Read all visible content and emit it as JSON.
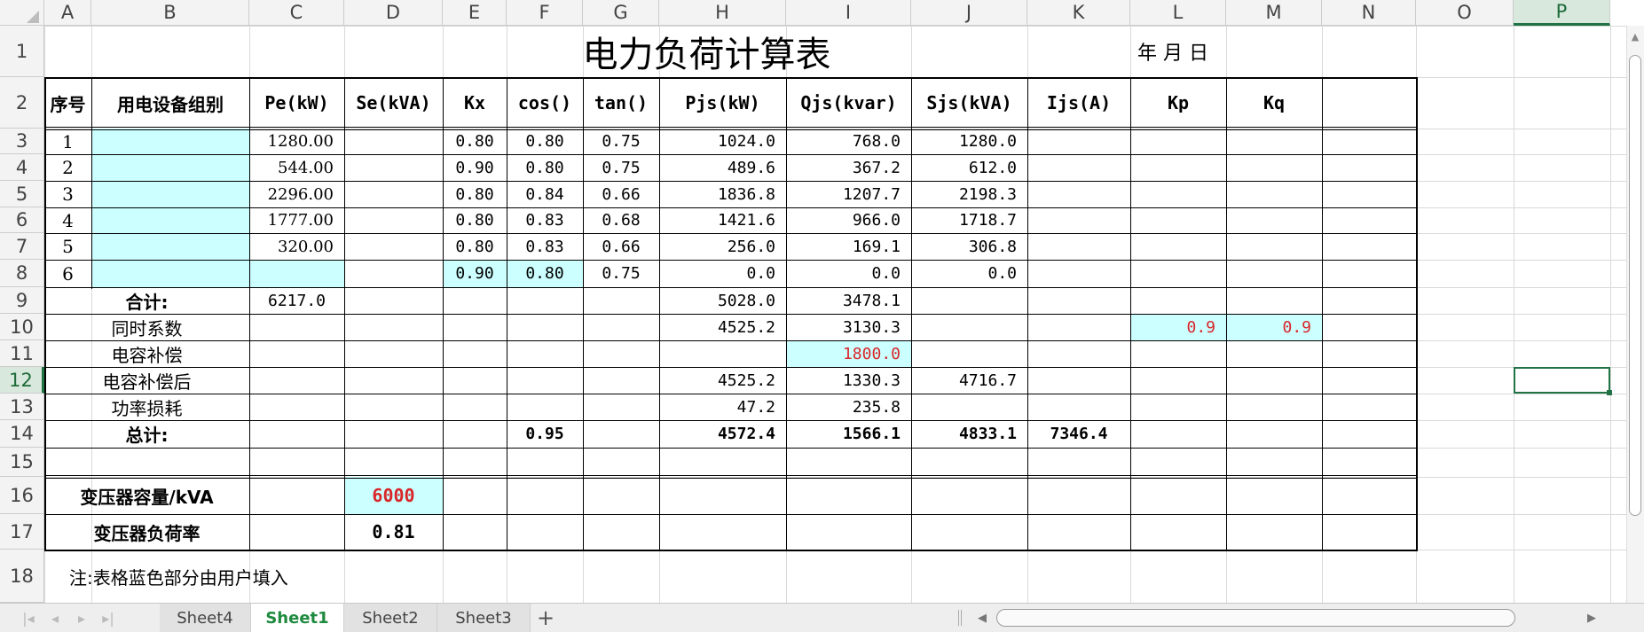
{
  "columns": [
    "A",
    "B",
    "C",
    "D",
    "E",
    "F",
    "G",
    "H",
    "I",
    "J",
    "K",
    "L",
    "M",
    "N",
    "O",
    "P"
  ],
  "rows": [
    "1",
    "2",
    "3",
    "4",
    "5",
    "6",
    "7",
    "8",
    "9",
    "10",
    "11",
    "12",
    "13",
    "14",
    "15",
    "16",
    "17",
    "18"
  ],
  "title": "电力负荷计算表",
  "date_label": "年    月    日",
  "headers": [
    "序号",
    "用电设备组别",
    "Pe(kW)",
    "Se(kVA)",
    "Kx",
    "cos()",
    "tan()",
    "Pjs(kW)",
    "Qjs(kvar)",
    "Sjs(kVA)",
    "Ijs(A)",
    "Kp",
    "Kq"
  ],
  "data_rows": [
    {
      "no": "1",
      "pe": "1280.00",
      "kx": "0.80",
      "cos": "0.80",
      "tan": "0.75",
      "pjs": "1024.0",
      "qjs": "768.0",
      "sjs": "1280.0"
    },
    {
      "no": "2",
      "pe": "544.00",
      "kx": "0.90",
      "cos": "0.80",
      "tan": "0.75",
      "pjs": "489.6",
      "qjs": "367.2",
      "sjs": "612.0"
    },
    {
      "no": "3",
      "pe": "2296.00",
      "kx": "0.80",
      "cos": "0.84",
      "tan": "0.66",
      "pjs": "1836.8",
      "qjs": "1207.7",
      "sjs": "2198.3"
    },
    {
      "no": "4",
      "pe": "1777.00",
      "kx": "0.80",
      "cos": "0.83",
      "tan": "0.68",
      "pjs": "1421.6",
      "qjs": "966.0",
      "sjs": "1718.7"
    },
    {
      "no": "5",
      "pe": "320.00",
      "kx": "0.80",
      "cos": "0.83",
      "tan": "0.66",
      "pjs": "256.0",
      "qjs": "169.1",
      "sjs": "306.8"
    },
    {
      "no": "6",
      "pe": "",
      "kx": "0.90",
      "cos": "0.80",
      "tan": "0.75",
      "pjs": "0.0",
      "qjs": "0.0",
      "sjs": "0.0"
    }
  ],
  "subtotal": {
    "label": "合计:",
    "pe": "6217.0",
    "pjs": "5028.0",
    "qjs": "3478.1"
  },
  "simultaneity": {
    "label": "同时系数",
    "pjs": "4525.2",
    "qjs": "3130.3",
    "kp": "0.9",
    "kq": "0.9"
  },
  "capacitor": {
    "label": "电容补偿",
    "qjs": "1800.0"
  },
  "after_comp": {
    "label": "电容补偿后",
    "pjs": "4525.2",
    "qjs": "1330.3",
    "sjs": "4716.7"
  },
  "loss": {
    "label": "功率损耗",
    "pjs": "47.2",
    "qjs": "235.8"
  },
  "total": {
    "label": "总计:",
    "cos": "0.95",
    "pjs": "4572.4",
    "qjs": "1566.1",
    "sjs": "4833.1",
    "ijs": "7346.4"
  },
  "transformer_capacity": {
    "label": "变压器容量/kVA",
    "value": "6000"
  },
  "transformer_load": {
    "label": "变压器负荷率",
    "value": "0.81"
  },
  "note": "注:表格蓝色部分由用户填入",
  "sheet_tabs": [
    "Sheet4",
    "Sheet1",
    "Sheet2",
    "Sheet3"
  ],
  "active_tab": "Sheet1",
  "add_tab": "+",
  "colors": {
    "input_fill": "#ccffff",
    "red_value": "#d8262a",
    "active_tab": "#1e8a3e",
    "selection": "#217346"
  }
}
